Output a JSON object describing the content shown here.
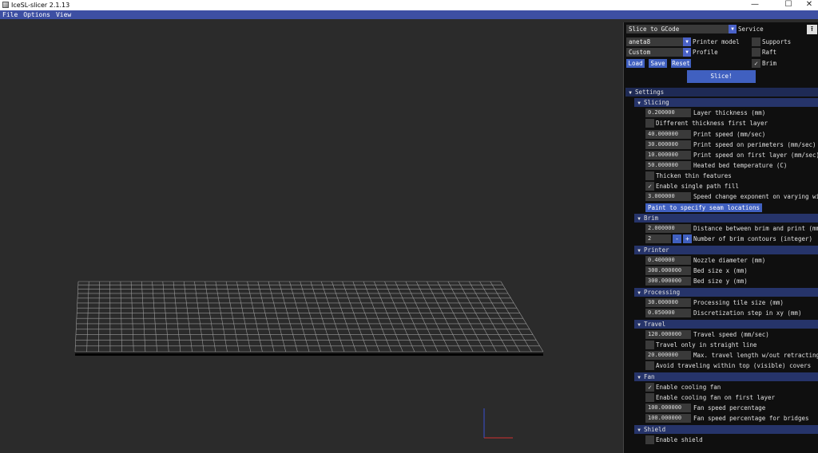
{
  "window": {
    "title": "IceSL-slicer 2.1.13",
    "controls": {
      "minimize": "—",
      "maximize": "☐",
      "close": "✕"
    }
  },
  "menu": [
    "File",
    "Options",
    "View"
  ],
  "top": {
    "service_select": "Slice to GCode",
    "service_label": "Service",
    "printer_select": "aneta8",
    "printer_label": "Printer model",
    "profile_select": "Custom",
    "profile_label": "Profile",
    "supports_label": "Supports",
    "supports_checked": false,
    "raft_label": "Raft",
    "raft_checked": false,
    "brim_label": "Brim",
    "brim_checked": true,
    "load_label": "Load",
    "save_label": "Save",
    "reset_label": "Reset",
    "slice_label": "Slice!"
  },
  "settings": {
    "title": "Settings",
    "slicing": {
      "title": "Slicing",
      "layer_thickness": "0.200000",
      "layer_thickness_label": "Layer thickness (mm)",
      "diff_thickness_label": "Different thickness first layer",
      "diff_thickness_checked": false,
      "print_speed": "40.000000",
      "print_speed_label": "Print speed (mm/sec)",
      "perimeter_speed": "30.000000",
      "perimeter_speed_label": "Print speed on perimeters (mm/sec)",
      "first_layer_speed": "10.000000",
      "first_layer_speed_label": "Print speed on first layer (mm/sec)",
      "bed_temp": "50.000000",
      "bed_temp_label": "Heated bed temperature (C)",
      "thicken_label": "Thicken thin features",
      "thicken_checked": false,
      "single_path_label": "Enable single path fill",
      "single_path_checked": true,
      "speed_exp": "3.000000",
      "speed_exp_label": "Speed change exponent on varying width",
      "seam_button": "Paint to specify seam locations"
    },
    "brim": {
      "title": "Brim",
      "distance": "2.000000",
      "distance_label": "Distance between brim and print (mm)",
      "contours": "2",
      "minus": "-",
      "plus": "+",
      "contours_label": "Number of brim contours (integer)"
    },
    "printer": {
      "title": "Printer",
      "nozzle": "0.400000",
      "nozzle_label": "Nozzle diameter (mm)",
      "bed_x": "300.000000",
      "bed_x_label": "Bed size x (mm)",
      "bed_y": "300.000000",
      "bed_y_label": "Bed size y (mm)"
    },
    "processing": {
      "title": "Processing",
      "tile_size": "30.000000",
      "tile_size_label": "Processing tile size (mm)",
      "disc_step": "0.050000",
      "disc_step_label": "Discretization step in xy (mm)"
    },
    "travel": {
      "title": "Travel",
      "speed": "120.000000",
      "speed_label": "Travel speed (mm/sec)",
      "straight_label": "Travel only in straight line",
      "straight_checked": false,
      "max_len": "20.000000",
      "max_len_label": "Max. travel length w/out retracting",
      "avoid_label": "Avoid traveling within top (visible) covers",
      "avoid_checked": false
    },
    "fan": {
      "title": "Fan",
      "cooling_label": "Enable cooling fan",
      "cooling_checked": true,
      "first_layer_label": "Enable cooling fan on first layer",
      "first_layer_checked": false,
      "speed_pct": "100.000000",
      "speed_pct_label": "Fan speed percentage",
      "bridge_pct": "100.000000",
      "bridge_pct_label": "Fan speed percentage for bridges"
    },
    "shield": {
      "title": "Shield",
      "enable_label": "Enable shield",
      "enable_checked": false
    }
  },
  "icons": {
    "dropdown": "▼",
    "collapse": "▼",
    "upload": "⭱",
    "check": "✓"
  },
  "colors": {
    "menubar": "#3d4fa3",
    "accent": "#4060c0",
    "header": "#1e2a55",
    "viewport_bg": "#2b2b2b",
    "grid": "#9a9a9a"
  }
}
